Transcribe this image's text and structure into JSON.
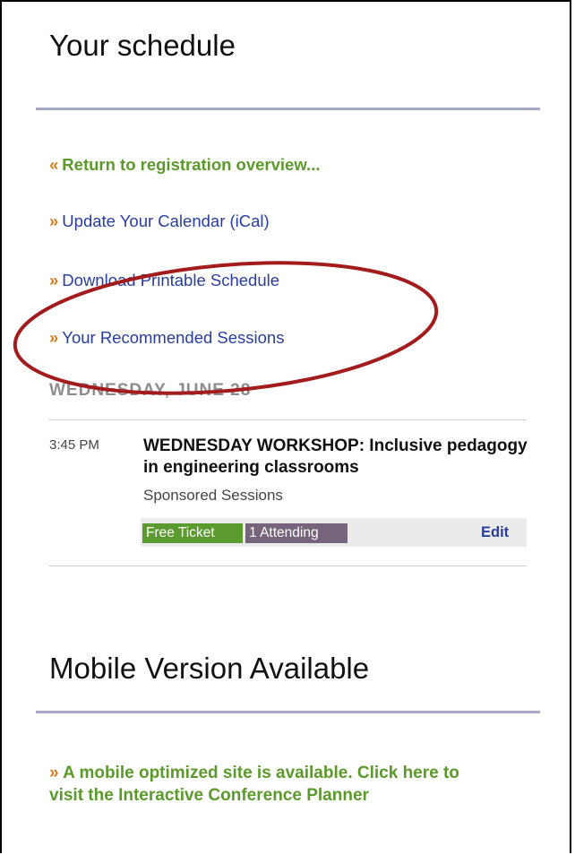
{
  "schedule": {
    "title": "Your schedule",
    "links": [
      {
        "arrow": "«",
        "label": "Return to registration overview..."
      },
      {
        "arrow": "»",
        "label": "Update Your Calendar (iCal)"
      },
      {
        "arrow": "»",
        "label": "Download Printable Schedule"
      },
      {
        "arrow": "»",
        "label": "Your Recommended Sessions"
      }
    ],
    "day": "WEDNESDAY, JUNE 28",
    "session": {
      "time": "3:45 PM",
      "title": "WEDNESDAY WORKSHOP: Inclusive pedagogy in engineering classrooms",
      "track": "Sponsored Sessions",
      "ticket": "Free Ticket",
      "attending": "1 Attending",
      "edit": "Edit"
    }
  },
  "mobile": {
    "title": "Mobile Version Available",
    "arrow": "»",
    "text": "A mobile optimized site is available. Click here to visit the Interactive Conference Planner"
  },
  "colors": {
    "green_link": "#5a9a2a",
    "blue_link": "#283d9e",
    "orange_arrow": "#d57a20",
    "annotation_ellipse": "#a31b1b"
  }
}
